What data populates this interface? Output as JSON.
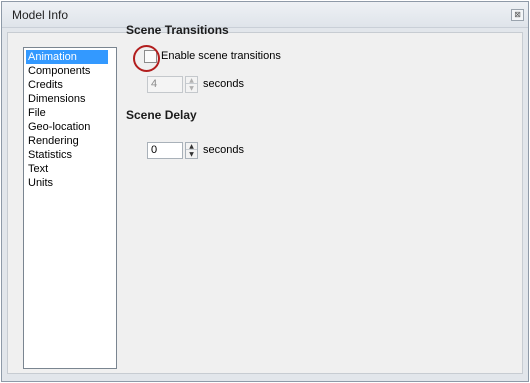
{
  "window": {
    "title": "Model Info",
    "close_symbol": "⊠"
  },
  "sidebar": {
    "items": [
      {
        "label": "Animation",
        "selected": true
      },
      {
        "label": "Components"
      },
      {
        "label": "Credits"
      },
      {
        "label": "Dimensions"
      },
      {
        "label": "File"
      },
      {
        "label": "Geo-location"
      },
      {
        "label": "Rendering"
      },
      {
        "label": "Statistics"
      },
      {
        "label": "Text"
      },
      {
        "label": "Units"
      }
    ]
  },
  "scene_transitions": {
    "heading": "Scene Transitions",
    "enable_label": "Enable scene transitions",
    "enable_checked": false,
    "duration_value": "4",
    "duration_unit": "seconds"
  },
  "scene_delay": {
    "heading": "Scene Delay",
    "delay_value": "0",
    "delay_unit": "seconds"
  },
  "colors": {
    "selection": "#3399ff",
    "highlight_ring": "#b21e1e"
  },
  "icons": {
    "close": "close-icon",
    "spin_up": "chevron-up-icon",
    "spin_down": "chevron-down-icon"
  }
}
